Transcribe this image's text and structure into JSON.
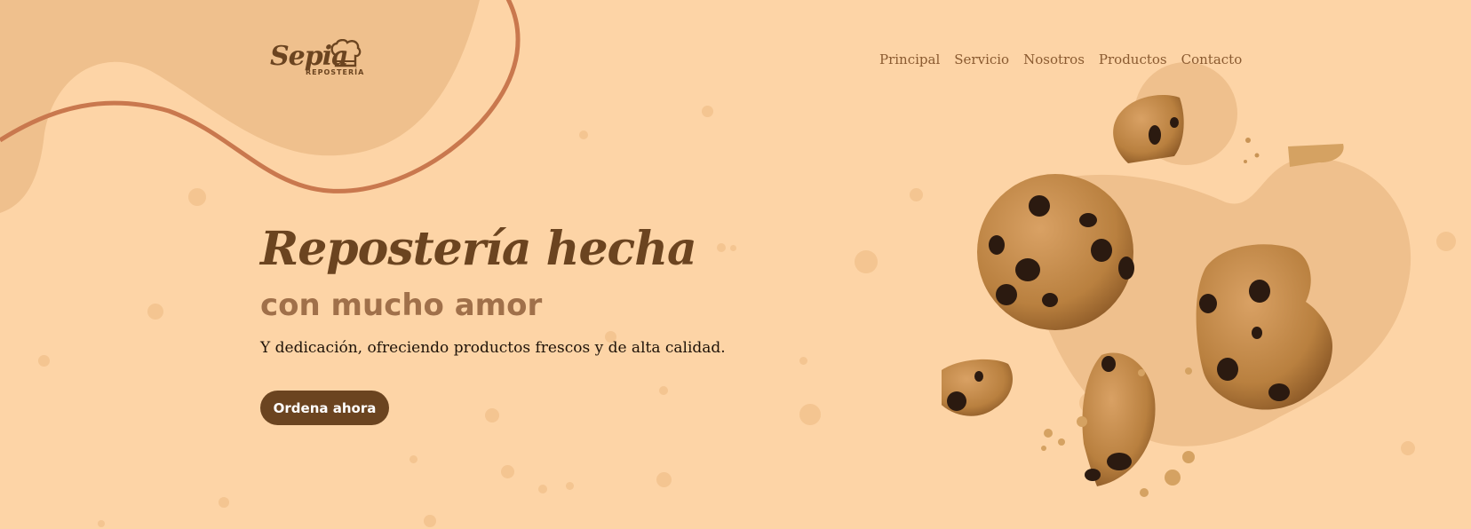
{
  "brand": {
    "logo_script": "Sepia",
    "logo_sub": "REPOSTERÍA",
    "primary_color": "#6b4420",
    "background_color": "#fdd4a6",
    "accent_color": "#c9784e"
  },
  "nav": {
    "items": [
      {
        "label": "Principal"
      },
      {
        "label": "Servicio"
      },
      {
        "label": "Nosotros"
      },
      {
        "label": "Productos"
      },
      {
        "label": "Contacto"
      }
    ]
  },
  "hero": {
    "title": "Repostería hecha",
    "subtitle": "con mucho amor",
    "description": "Y dedicación, ofreciendo productos frescos y de alta calidad.",
    "cta_label": "Ordena ahora"
  },
  "illustration": {
    "subject": "chocolate-chip-cookies",
    "count_whole": 2,
    "count_broken": 4
  }
}
